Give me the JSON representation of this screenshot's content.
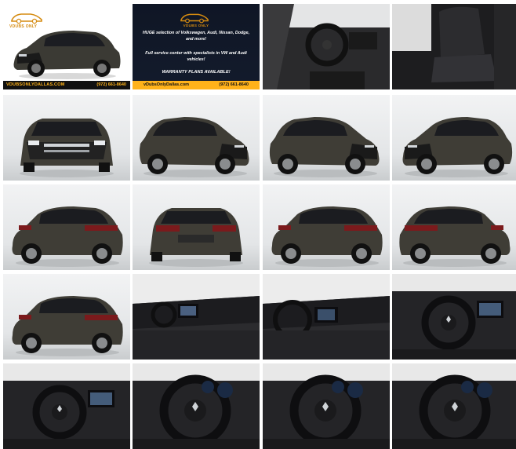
{
  "gallery": {
    "banner_left": {
      "brand": "VDUBS ONLY",
      "url": "VDUBSONLYDALLAS.COM",
      "phone": "(972) 661-8640"
    },
    "banner_right": {
      "brand": "VDUBS ONLY",
      "line1": "HUGE selection of Volkswagen, Audi, Nissan, Dodge, and more!",
      "line2": "Full service center with specialists in VW and Audi vehicles!",
      "line3": "WARRANTY PLANS AVAILABLE!",
      "url": "vDubsOnlyDallas.com",
      "phone": "(972) 661-8640"
    },
    "photos": [
      {
        "name": "exterior-front-quarter",
        "kind": "ext-front3q"
      },
      {
        "name": "dealer-banner",
        "kind": "banner"
      },
      {
        "name": "interior-driver-door",
        "kind": "int-door"
      },
      {
        "name": "interior-front-seats",
        "kind": "int-seats"
      },
      {
        "name": "exterior-front",
        "kind": "ext-front"
      },
      {
        "name": "exterior-front-left",
        "kind": "ext-front3q-left"
      },
      {
        "name": "exterior-front-left-2",
        "kind": "ext-front3q-left"
      },
      {
        "name": "exterior-front-right",
        "kind": "ext-front3q"
      },
      {
        "name": "exterior-rear-left",
        "kind": "ext-rear3q"
      },
      {
        "name": "exterior-rear",
        "kind": "ext-rear"
      },
      {
        "name": "exterior-rear-right",
        "kind": "ext-rear3q"
      },
      {
        "name": "exterior-side-rear",
        "kind": "ext-rear3q-right"
      },
      {
        "name": "exterior-rear-quarter",
        "kind": "ext-rear3q"
      },
      {
        "name": "interior-dash-passenger",
        "kind": "int-dash"
      },
      {
        "name": "interior-dash-center",
        "kind": "int-dash-center"
      },
      {
        "name": "interior-steering",
        "kind": "int-wheel"
      },
      {
        "name": "interior-cockpit",
        "kind": "int-wheel"
      },
      {
        "name": "interior-steering-closeup",
        "kind": "int-wheel-close"
      },
      {
        "name": "interior-steering-closeup-2",
        "kind": "int-wheel-close"
      },
      {
        "name": "interior-gauges",
        "kind": "int-wheel-close"
      }
    ]
  }
}
